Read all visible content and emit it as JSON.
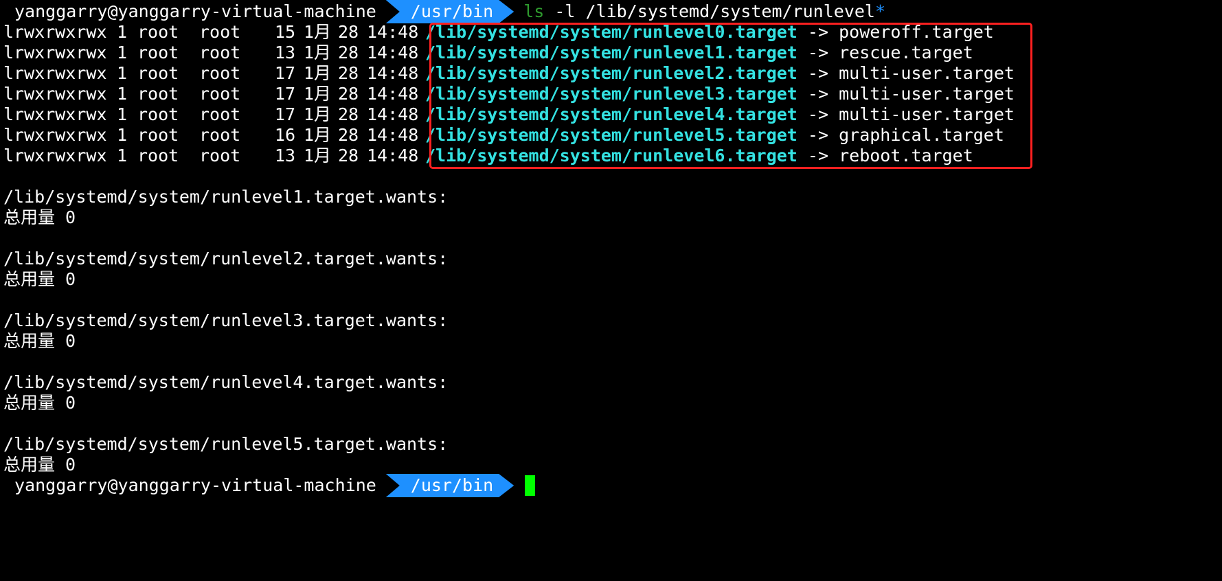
{
  "prompt": {
    "user_host": "yanggarry@yanggarry-virtual-machine",
    "cwd": "/usr/bin"
  },
  "command": {
    "program": "ls",
    "args": " -l /lib/systemd/system/runlevel",
    "glob": "*"
  },
  "listing": [
    {
      "perm": "lrwxrwxrwx",
      "links": "1",
      "owner": "root",
      "group": "root",
      "size": "15",
      "month": "1月",
      "day": "28",
      "time": "14:48",
      "path": "/lib/systemd/system/runlevel0.target",
      "arrow": "->",
      "target": "poweroff.target"
    },
    {
      "perm": "lrwxrwxrwx",
      "links": "1",
      "owner": "root",
      "group": "root",
      "size": "13",
      "month": "1月",
      "day": "28",
      "time": "14:48",
      "path": "/lib/systemd/system/runlevel1.target",
      "arrow": "->",
      "target": "rescue.target"
    },
    {
      "perm": "lrwxrwxrwx",
      "links": "1",
      "owner": "root",
      "group": "root",
      "size": "17",
      "month": "1月",
      "day": "28",
      "time": "14:48",
      "path": "/lib/systemd/system/runlevel2.target",
      "arrow": "->",
      "target": "multi-user.target"
    },
    {
      "perm": "lrwxrwxrwx",
      "links": "1",
      "owner": "root",
      "group": "root",
      "size": "17",
      "month": "1月",
      "day": "28",
      "time": "14:48",
      "path": "/lib/systemd/system/runlevel3.target",
      "arrow": "->",
      "target": "multi-user.target"
    },
    {
      "perm": "lrwxrwxrwx",
      "links": "1",
      "owner": "root",
      "group": "root",
      "size": "17",
      "month": "1月",
      "day": "28",
      "time": "14:48",
      "path": "/lib/systemd/system/runlevel4.target",
      "arrow": "->",
      "target": "multi-user.target"
    },
    {
      "perm": "lrwxrwxrwx",
      "links": "1",
      "owner": "root",
      "group": "root",
      "size": "16",
      "month": "1月",
      "day": "28",
      "time": "14:48",
      "path": "/lib/systemd/system/runlevel5.target",
      "arrow": "->",
      "target": "graphical.target"
    },
    {
      "perm": "lrwxrwxrwx",
      "links": "1",
      "owner": "root",
      "group": "root",
      "size": "13",
      "month": "1月",
      "day": "28",
      "time": "14:48",
      "path": "/lib/systemd/system/runlevel6.target",
      "arrow": "->",
      "target": "reboot.target"
    }
  ],
  "wants_dirs": [
    {
      "header": "/lib/systemd/system/runlevel1.target.wants:",
      "total": "总用量 0"
    },
    {
      "header": "/lib/systemd/system/runlevel2.target.wants:",
      "total": "总用量 0"
    },
    {
      "header": "/lib/systemd/system/runlevel3.target.wants:",
      "total": "总用量 0"
    },
    {
      "header": "/lib/systemd/system/runlevel4.target.wants:",
      "total": "总用量 0"
    },
    {
      "header": "/lib/systemd/system/runlevel5.target.wants:",
      "total": "总用量 0"
    }
  ],
  "colors": {
    "background": "#000000",
    "text": "#ffffff",
    "prompt_segment": "#1e90ff",
    "command": "#2e9b2e",
    "symlink": "#34e2e2",
    "cursor": "#00ff00",
    "highlight_box": "#ff2020"
  }
}
